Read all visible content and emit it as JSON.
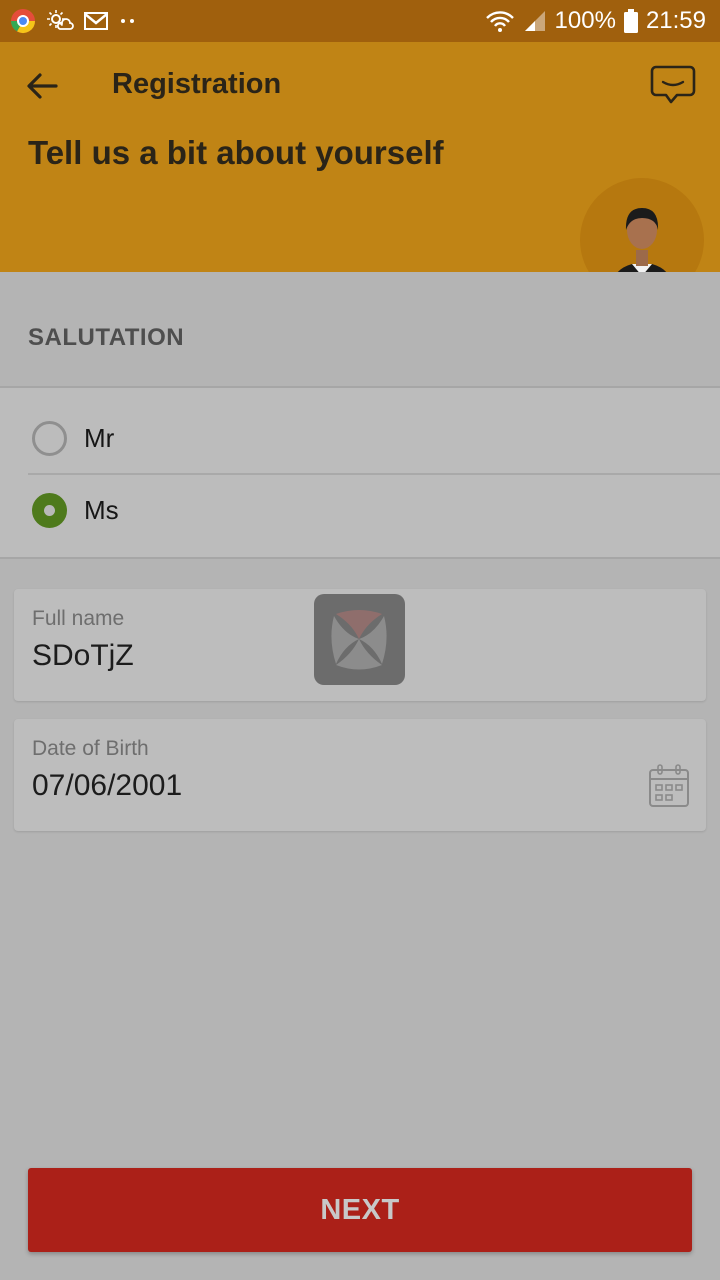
{
  "status_bar": {
    "battery": "100%",
    "time": "21:59",
    "icons": [
      "chrome-icon",
      "weather-icon",
      "gmail-icon",
      "more-dots-icon",
      "wifi-icon",
      "signal-icon",
      "battery-icon"
    ]
  },
  "header": {
    "title": "Registration",
    "tagline": "Tell us a bit about yourself",
    "back_icon": "back-arrow-icon",
    "chat_icon": "chat-icon",
    "accent_color": "#c08415"
  },
  "salutation": {
    "label": "SALUTATION",
    "options": [
      {
        "label": "Mr",
        "selected": false
      },
      {
        "label": "Ms",
        "selected": true
      }
    ],
    "selected_color": "#4e7a1c"
  },
  "fields": {
    "full_name": {
      "label": "Full name",
      "value": "SDoTjZ"
    },
    "dob": {
      "label": "Date of Birth",
      "value": "07/06/2001",
      "icon": "calendar-icon"
    }
  },
  "next_button": {
    "label": "NEXT",
    "color": "#ab2018"
  }
}
